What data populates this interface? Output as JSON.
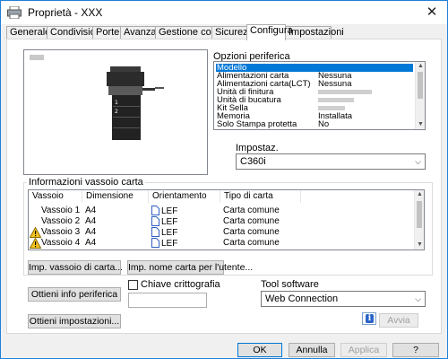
{
  "window": {
    "title": "Proprietà - XXX",
    "close_glyph": "✕"
  },
  "tabs": [
    {
      "label": "Generale"
    },
    {
      "label": "Condivisione"
    },
    {
      "label": "Porte"
    },
    {
      "label": "Avanzate"
    },
    {
      "label": "Gestione colori"
    },
    {
      "label": "Sicurezza"
    },
    {
      "label": "Configura",
      "active": true
    },
    {
      "label": "Impostazioni"
    }
  ],
  "options": {
    "title": "Opzioni periferica",
    "rows": [
      {
        "name": "Modello",
        "value": "",
        "selected": true
      },
      {
        "name": "Alimentazioni carta",
        "value": "Nessuna"
      },
      {
        "name": "Alimentazioni carta(LCT)",
        "value": "Nessuna"
      },
      {
        "name": "Unità di finitura",
        "value": ""
      },
      {
        "name": "Unità di bucatura",
        "value": ""
      },
      {
        "name": "Kit Sella",
        "value": ""
      },
      {
        "name": "Memoria",
        "value": "Installata"
      },
      {
        "name": "Solo Stampa protetta",
        "value": "No"
      }
    ],
    "setting_label": "Impostaz.",
    "setting_value": "C360i"
  },
  "tray_info": {
    "title": "Informazioni vassoio carta",
    "columns": [
      "Vassoio",
      "Dimensione",
      "Orientamento",
      "Tipo di carta"
    ],
    "rows": [
      {
        "tray": "Vassoio 1",
        "size": "A4",
        "orientation": "LEF",
        "type": "Carta comune",
        "warning": false
      },
      {
        "tray": "Vassoio 2",
        "size": "A4",
        "orientation": "LEF",
        "type": "Carta comune",
        "warning": false
      },
      {
        "tray": "Vassoio 3",
        "size": "A4",
        "orientation": "LEF",
        "type": "Carta comune",
        "warning": true
      },
      {
        "tray": "Vassoio 4",
        "size": "A4",
        "orientation": "LEF",
        "type": "Carta comune",
        "warning": true
      }
    ],
    "btn_tray_settings": "Imp. vassoio di carta...",
    "btn_paper_name": "Imp. nome carta per l'utente..."
  },
  "bottom": {
    "btn_get_device_info": "Ottieni info periferica",
    "encryption_label": "Chiave crittografia",
    "btn_get_settings": "Ottieni impostazioni...",
    "software_tool_label": "Tool software",
    "software_tool_value": "Web Connection",
    "info_glyph": "i",
    "btn_launch": "Avvia"
  },
  "footer": {
    "ok": "OK",
    "cancel": "Annulla",
    "apply": "Applica",
    "help": "?"
  }
}
